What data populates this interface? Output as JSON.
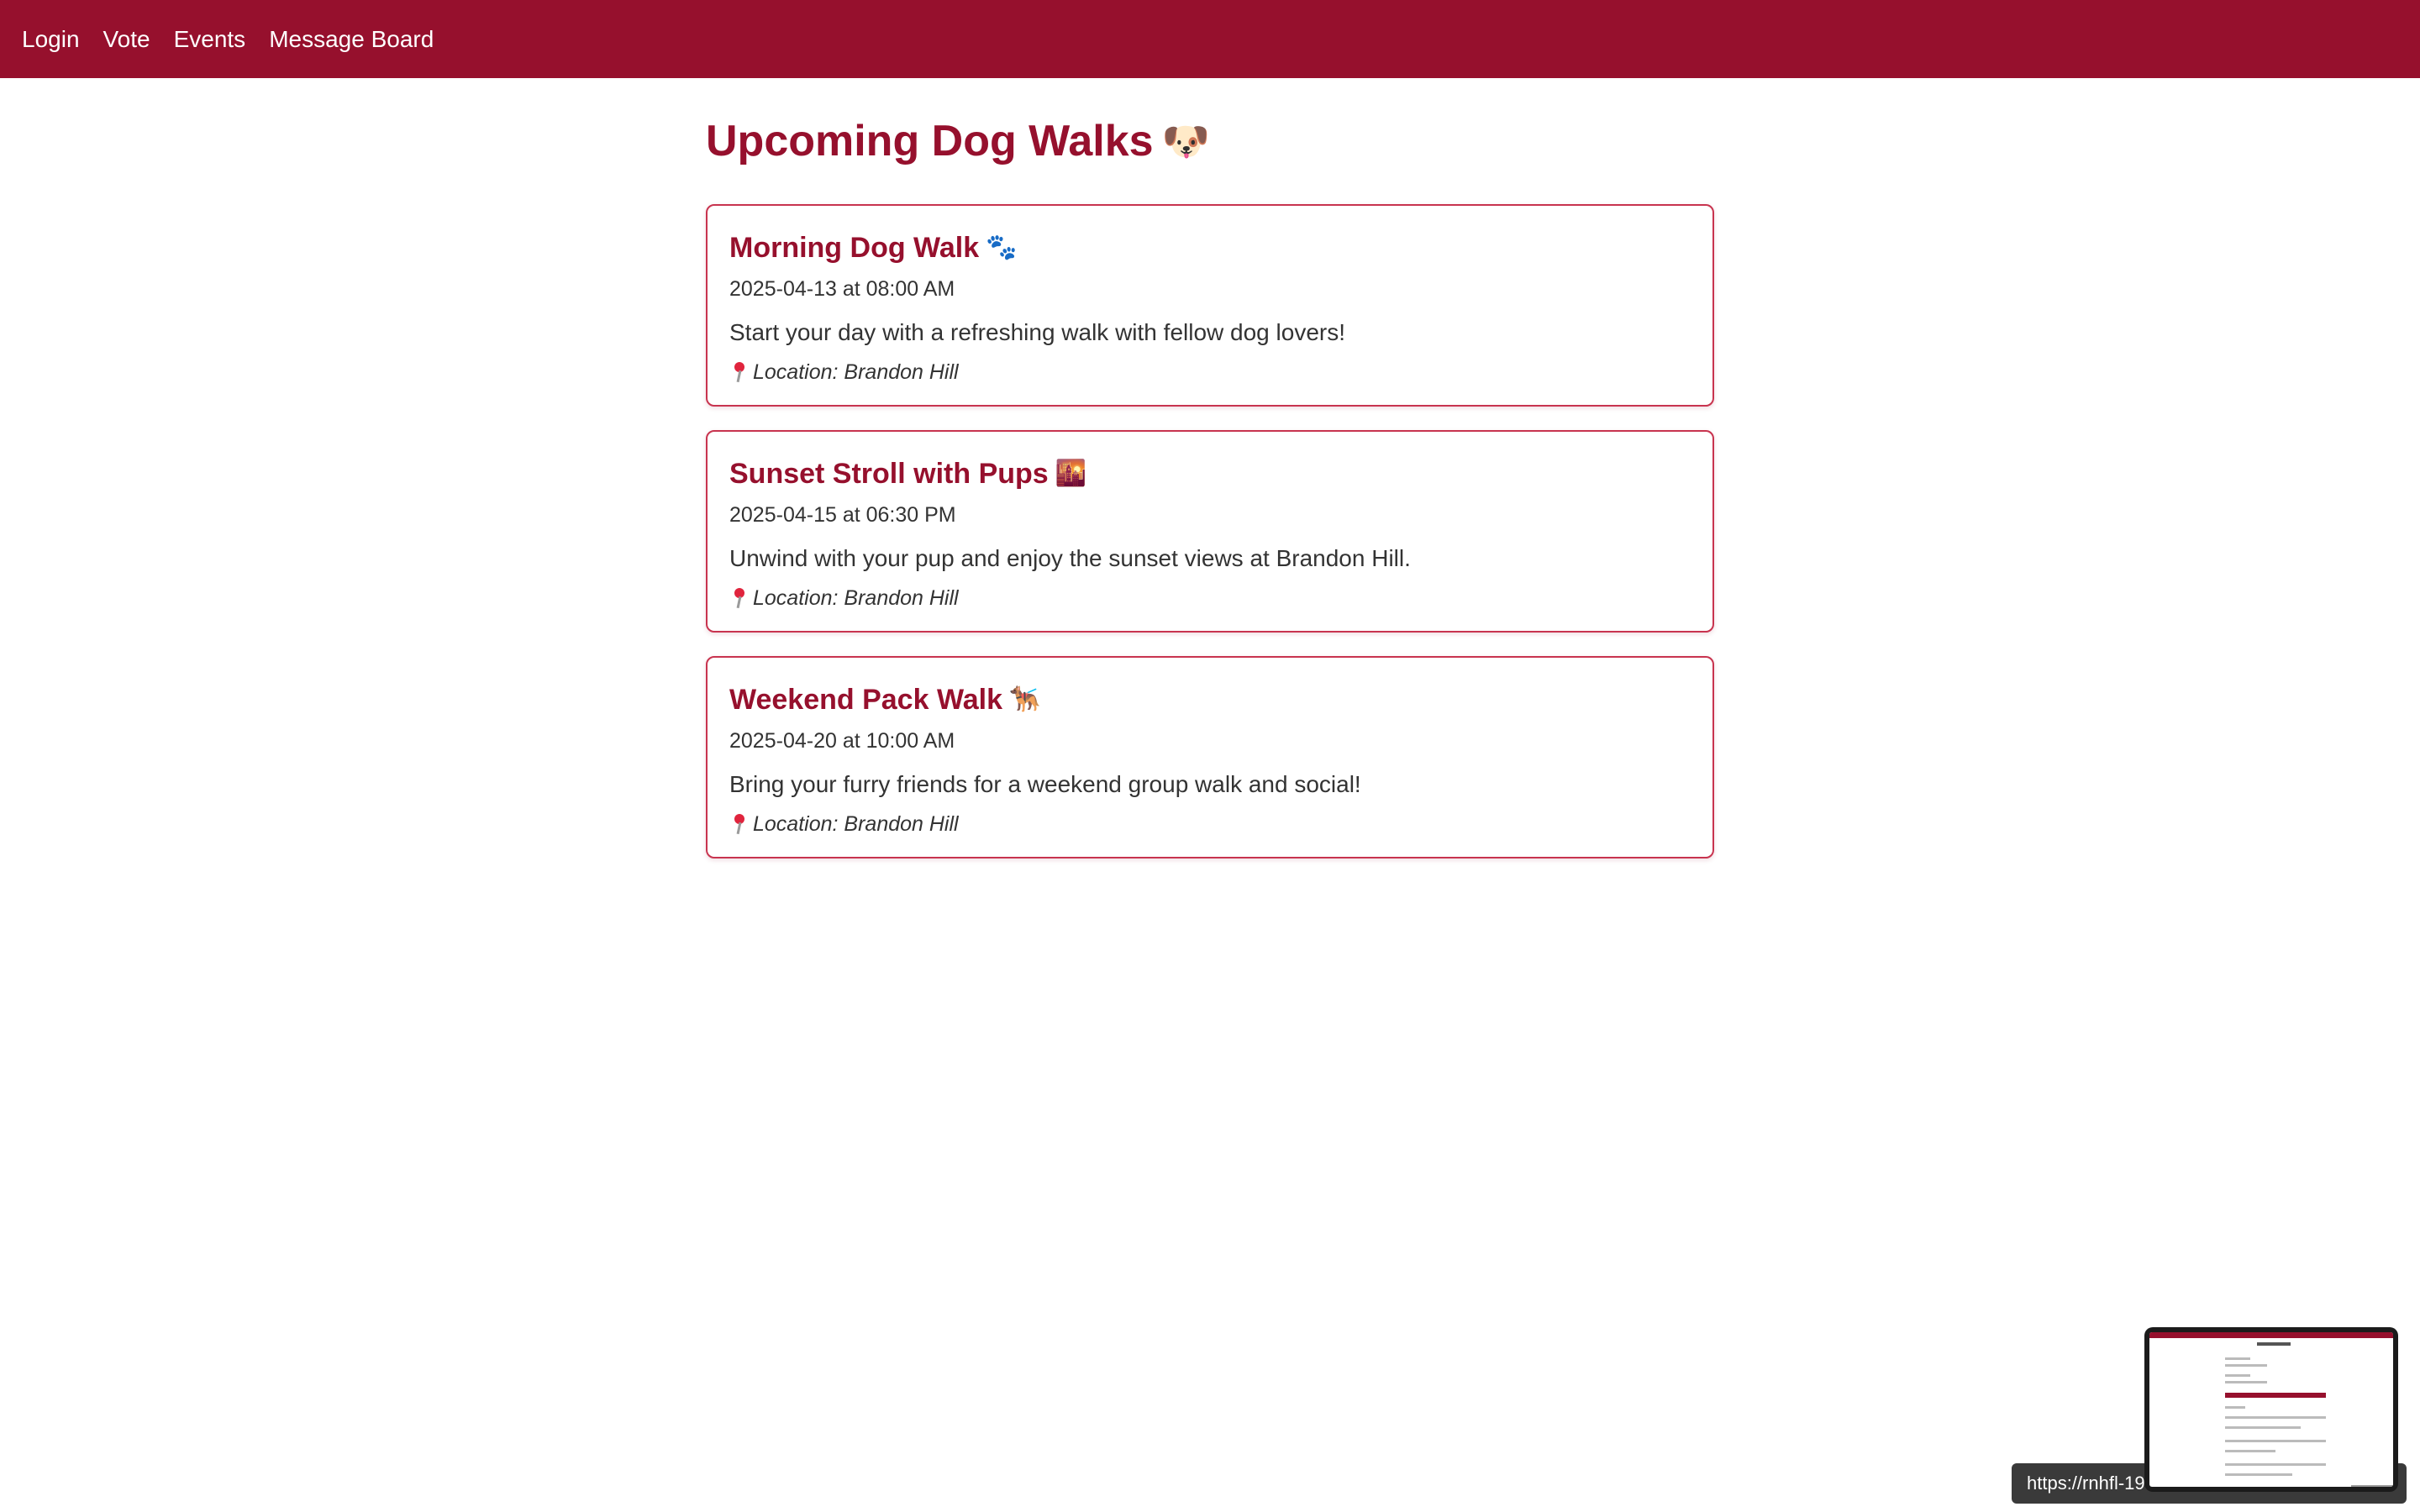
{
  "nav": {
    "items": [
      {
        "label": "Login"
      },
      {
        "label": "Vote"
      },
      {
        "label": "Events"
      },
      {
        "label": "Message Board"
      }
    ]
  },
  "page": {
    "title": "Upcoming Dog Walks",
    "title_emoji": "🐶"
  },
  "events": [
    {
      "title": "Morning Dog Walk",
      "emoji": "🐾",
      "datetime": "2025-04-13 at 08:00 AM",
      "description": "Start your day with a refreshing walk with fellow dog lovers!",
      "location": "Location: Brandon Hill"
    },
    {
      "title": "Sunset Stroll with Pups",
      "emoji": "🌇",
      "datetime": "2025-04-15 at 06:30 PM",
      "description": "Unwind with your pup and enjoy the sunset views at Brandon Hill.",
      "location": "Location: Brandon Hill"
    },
    {
      "title": "Weekend Pack Walk",
      "emoji": "🐕‍🦺",
      "datetime": "2025-04-20 at 10:00 AM",
      "description": "Bring your furry friends for a weekend group walk and social!",
      "location": "Location: Brandon Hill"
    }
  ],
  "status_bar": {
    "url": "https://rnhfl-19"
  },
  "colors": {
    "brand": "#96102d",
    "card_border": "#c8344f"
  }
}
